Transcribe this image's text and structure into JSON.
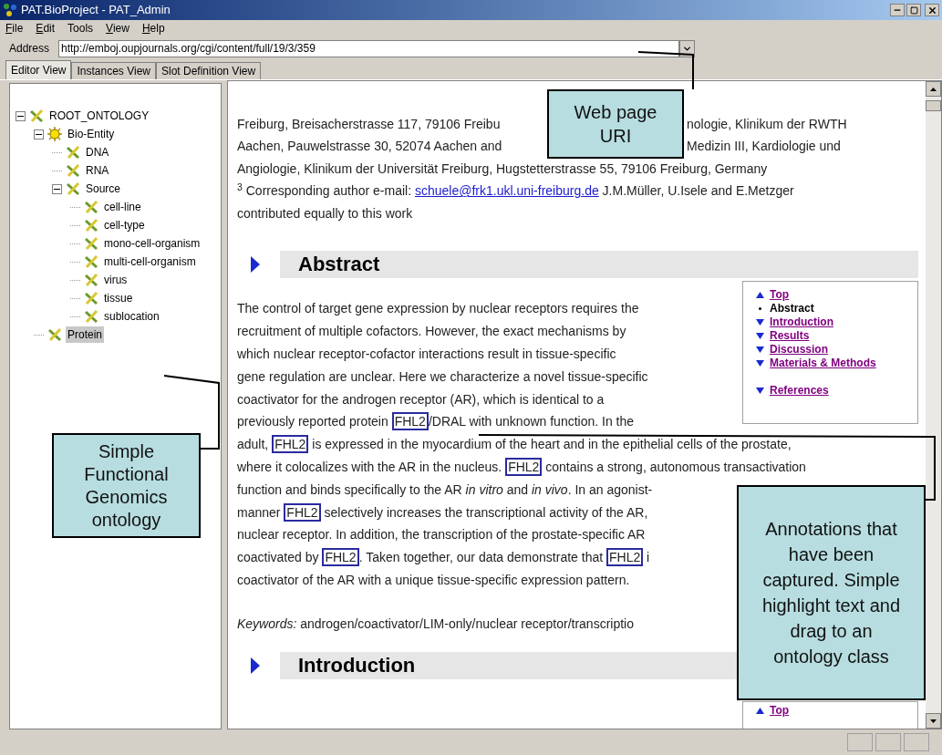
{
  "window": {
    "title": "PAT.BioProject - PAT_Admin"
  },
  "menu": [
    {
      "label": "File",
      "mnemonic": true
    },
    {
      "label": "Edit",
      "mnemonic": true
    },
    {
      "label": "Tools",
      "mnemonic": false
    },
    {
      "label": "View",
      "mnemonic": true
    },
    {
      "label": "Help",
      "mnemonic": true
    }
  ],
  "address": {
    "label": "Address",
    "value": "http://emboj.oupjournals.org/cgi/content/full/19/3/359"
  },
  "tabs": [
    {
      "label": "Editor View",
      "selected": true
    },
    {
      "label": "Instances View",
      "selected": false
    },
    {
      "label": "Slot Definition View",
      "selected": false
    }
  ],
  "tree": [
    {
      "label": "ROOT_ONTOLOGY",
      "kind": "class",
      "expanded": true,
      "selected": false,
      "children": [
        {
          "label": "Bio-Entity",
          "kind": "category",
          "expanded": true,
          "selected": false,
          "children": [
            {
              "label": "DNA",
              "kind": "class",
              "selected": false
            },
            {
              "label": "RNA",
              "kind": "class",
              "selected": false
            },
            {
              "label": "Source",
              "kind": "class",
              "expanded": true,
              "selected": false,
              "children": [
                {
                  "label": "cell-line",
                  "kind": "class",
                  "selected": false
                },
                {
                  "label": "cell-type",
                  "kind": "class",
                  "selected": false
                },
                {
                  "label": "mono-cell-organism",
                  "kind": "class",
                  "selected": false
                },
                {
                  "label": "multi-cell-organism",
                  "kind": "class",
                  "selected": false
                },
                {
                  "label": "virus",
                  "kind": "class",
                  "selected": false
                },
                {
                  "label": "tissue",
                  "kind": "class",
                  "selected": false
                },
                {
                  "label": "sublocation",
                  "kind": "class",
                  "selected": false
                }
              ]
            }
          ]
        },
        {
          "label": "Protein",
          "kind": "class",
          "selected": true
        }
      ]
    }
  ],
  "article": {
    "author_lines": [
      {
        "kind": "split",
        "left": "Freiburg, Breisacherstrasse 117, 79106 Freibu",
        "right": "nologie, Klinikum der RWTH"
      },
      {
        "kind": "split",
        "left": "Aachen, Pauwelstrasse 30, 52074 Aachen and",
        "right": "Medizin III, Kardiologie und"
      },
      {
        "kind": "plain",
        "text": "Angiologie, Klinikum der Universität Freiburg, Hugstetterstrasse 55, 79106 Freiburg, Germany"
      },
      {
        "kind": "footnote",
        "text": "$^{3}$ Corresponding author e-mail:",
        "link": "schuele@frk1.ukl.uni-freiburg.de",
        "after": "J.M.Müller, U.Isele and E.Metzger"
      },
      {
        "kind": "plain",
        "text": "contributed equally to this work"
      }
    ],
    "abstract_heading": "Abstract",
    "toc": [
      {
        "kind": "up",
        "label": "Top"
      },
      {
        "kind": "current",
        "label": "Abstract"
      },
      {
        "kind": "down",
        "label": "Introduction"
      },
      {
        "kind": "down",
        "label": "Results"
      },
      {
        "kind": "down",
        "label": "Discussion"
      },
      {
        "kind": "down",
        "label": "Materials & Methods"
      },
      {
        "kind": "gap-down",
        "label": "References"
      }
    ],
    "abstract_lines": [
      [
        {
          "kind": "text",
          "text": "The control of target gene expression by nuclear receptors requires the"
        }
      ],
      [
        {
          "kind": "text",
          "text": "recruitment of multiple cofactors. However, the exact mechanisms by"
        }
      ],
      [
        {
          "kind": "text",
          "text": "which nuclear receptor-cofactor interactions result in tissue-specific"
        }
      ],
      [
        {
          "kind": "text",
          "text": "gene regulation are unclear. Here we characterize a novel tissue-specific"
        }
      ],
      [
        {
          "kind": "text",
          "text": "coactivator for the androgen receptor (AR), which is identical to a"
        }
      ],
      [
        {
          "kind": "text",
          "text": "previously reported protein "
        },
        {
          "kind": "annotation",
          "text": "FHL2"
        },
        {
          "kind": "text",
          "text": "/DRAL with unknown function. In the"
        }
      ],
      [
        {
          "kind": "text",
          "text": "adult, "
        },
        {
          "kind": "annotation",
          "text": "FHL2"
        },
        {
          "kind": "text",
          "text": " is expressed in the myocardium of the heart and in the epithelial cells of the prostate,"
        }
      ],
      [
        {
          "kind": "text",
          "text": "where it colocalizes with the AR in the nucleus. "
        },
        {
          "kind": "annotation",
          "text": "FHL2"
        },
        {
          "kind": "text",
          "text": " contains a strong, autonomous transactivation"
        }
      ],
      [
        {
          "kind": "text",
          "text": "function and binds specifically to the AR *in vitro* and *in vivo*. In an agonist-"
        }
      ],
      [
        {
          "kind": "text",
          "text": "manner "
        },
        {
          "kind": "annotation",
          "text": "FHL2"
        },
        {
          "kind": "text",
          "text": " selectively increases the transcriptional activity of the AR,"
        }
      ],
      [
        {
          "kind": "text",
          "text": "nuclear receptor. In addition, the transcription of the prostate-specific AR"
        }
      ],
      [
        {
          "kind": "text",
          "text": "coactivated by "
        },
        {
          "kind": "annotation",
          "text": "FHL2"
        },
        {
          "kind": "text",
          "text": ". Taken together, our data demonstrate that "
        },
        {
          "kind": "annotation",
          "text": "FHL2"
        },
        {
          "kind": "text",
          "text": " i"
        }
      ],
      [
        {
          "kind": "text",
          "text": "coactivator of the AR with a unique tissue-specific expression pattern."
        }
      ]
    ],
    "keywords": "*Keywords:* androgen/coactivator/LIM-only/nuclear receptor/transcriptio",
    "introduction_heading": "Introduction",
    "toc_bottom": [
      {
        "kind": "up",
        "label": "Top"
      }
    ]
  },
  "callouts": [
    "Web page URI",
    "Simple Functional Genomics ontology",
    "Annotations that have been captured. Simple highlight text and drag to an ontology class"
  ]
}
